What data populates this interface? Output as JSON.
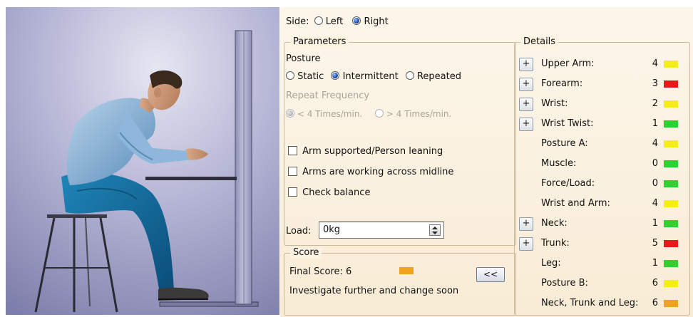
{
  "side": {
    "label": "Side:",
    "left_label": "Left",
    "right_label": "Right",
    "selected": "Right"
  },
  "parameters": {
    "legend": "Parameters",
    "posture_label": "Posture",
    "posture_options": [
      "Static",
      "Intermittent",
      "Repeated"
    ],
    "posture_selected": "Intermittent",
    "repeat_frequency_label": "Repeat Frequency",
    "frequency_options": [
      "< 4 Times/min.",
      "> 4 Times/min."
    ],
    "frequency_selected": "< 4 Times/min.",
    "checkboxes": [
      {
        "label": "Arm supported/Person leaning",
        "checked": false
      },
      {
        "label": "Arms are working across midline",
        "checked": false
      },
      {
        "label": "Check balance",
        "checked": false
      }
    ],
    "load_label": "Load:",
    "load_value": "0kg"
  },
  "score": {
    "legend": "Score",
    "final_score_text": "Final Score: 6",
    "final_color": "#f0a31c",
    "recommendation": "Investigate further and change soon",
    "collapse_button": "<<"
  },
  "details": {
    "legend": "Details",
    "items": [
      {
        "label": "Upper Arm:",
        "value": "4",
        "color": "#f5ee14",
        "expandable": true
      },
      {
        "label": "Forearm:",
        "value": "3",
        "color": "#e31b1b",
        "expandable": true
      },
      {
        "label": "Wrist:",
        "value": "2",
        "color": "#f5ee14",
        "expandable": true
      },
      {
        "label": "Wrist Twist:",
        "value": "1",
        "color": "#2fd12f",
        "expandable": true
      },
      {
        "label": "Posture A:",
        "value": "4",
        "color": "#f5ee14",
        "expandable": false
      },
      {
        "label": "Muscle:",
        "value": "0",
        "color": "#2fd12f",
        "expandable": false
      },
      {
        "label": "Force/Load:",
        "value": "0",
        "color": "#2fd12f",
        "expandable": false
      },
      {
        "label": "Wrist and Arm:",
        "value": "4",
        "color": "#f5ee14",
        "expandable": false
      },
      {
        "label": "Neck:",
        "value": "1",
        "color": "#2fd12f",
        "expandable": true
      },
      {
        "label": "Trunk:",
        "value": "5",
        "color": "#e31b1b",
        "expandable": true
      },
      {
        "label": "Leg:",
        "value": "1",
        "color": "#2fd12f",
        "expandable": false
      },
      {
        "label": "Posture B:",
        "value": "6",
        "color": "#f5ee14",
        "expandable": false
      },
      {
        "label": "Neck, Trunk and Leg:",
        "value": "6",
        "color": "#f0a31c",
        "expandable": false
      }
    ]
  }
}
